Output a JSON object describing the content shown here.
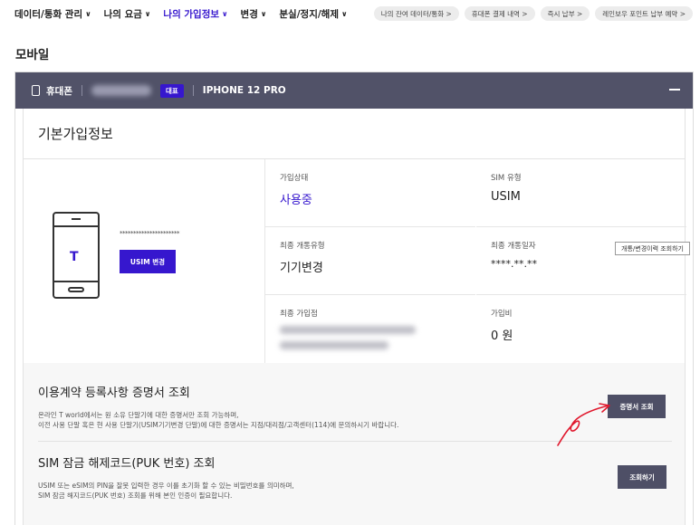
{
  "topnav": {
    "items": [
      {
        "label": "데이터/통화 관리",
        "active": false
      },
      {
        "label": "나의 요금",
        "active": false
      },
      {
        "label": "나의 가입정보",
        "active": true
      },
      {
        "label": "변경",
        "active": false
      },
      {
        "label": "분실/정지/해제",
        "active": false
      }
    ],
    "quick_links": [
      "나의 잔여 데이터/통화 >",
      "휴대폰 결제 내역 >",
      "즉시 납부 >",
      "레인보우 포인트 납부 예약 >"
    ]
  },
  "section_title": "모바일",
  "card": {
    "header": {
      "label": "휴대폰",
      "badge": "대표",
      "model": "IPHONE 12 PRO"
    },
    "info_title": "기본가입정보",
    "device": {
      "logo": "T",
      "masked_number": "**********************",
      "usim_button": "USIM 변경"
    },
    "fields": {
      "status_label": "가입상태",
      "status_value": "사용중",
      "sim_label": "SIM 유형",
      "sim_value": "USIM",
      "open_type_label": "최종 개통유형",
      "open_type_value": "기기변경",
      "open_date_label": "최종 개통일자",
      "open_date_value": "****.**.**",
      "history_button": "개통/변경이력 조회하기",
      "store_label": "최종 가입점",
      "fee_label": "가입비",
      "fee_value": "0 원"
    },
    "certificate": {
      "title": "이용계약 등록사항 증명서 조회",
      "desc1": "온라인 T world에서는 원 소유 단말기에 대한 증명서만 조회 가능하며,",
      "desc2": "이전 사용 단말 혹은 현 사용 단말기(USIM기기변경 단말)에 대한 증명서는 지점/대리점/고객센터(114)에 문의하시기 바랍니다.",
      "button": "증명서 조회"
    },
    "puk": {
      "title": "SIM 잠금 해제코드(PUK 번호) 조회",
      "desc1": "USIM 또는 eSIM의 PIN을 잘못 입력한 경우 이를 초기화 할 수 있는 비밀번호를 의미하며,",
      "desc2": "SIM 잠금 해지코드(PUK 번호) 조회를 위해 본인 인증이 필요합니다.",
      "button": "조회하기"
    }
  },
  "colors": {
    "accent": "#3617ce",
    "header_bg": "#515268",
    "button_dark": "#4e4f66",
    "annotation": "#e0182d"
  }
}
